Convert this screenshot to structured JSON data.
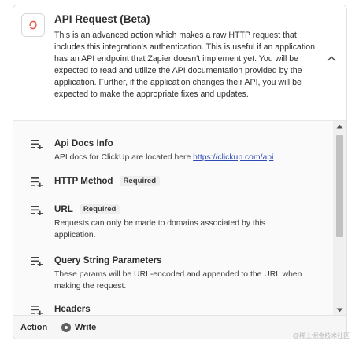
{
  "header": {
    "icon": "api-request-icon",
    "title": "API Request (Beta)",
    "description": "This is an advanced action which makes a raw HTTP request that includes this integration's authentication. This is useful if an application has an API endpoint that Zapier doesn't implement yet. You will be expected to read and utilize the API documentation provided by the application. Further, if the application changes their API, you will be expected to make the appropriate fixes and updates.",
    "collapse_icon": "chevron-up-icon"
  },
  "fields": [
    {
      "label": "Api Docs Info",
      "required": "",
      "description": "API docs for ClickUp are located here ",
      "link": "https://clickup.com/api"
    },
    {
      "label": "HTTP Method",
      "required": "Required",
      "description": ""
    },
    {
      "label": "URL",
      "required": "Required",
      "description": "Requests can only be made to domains associated by this application."
    },
    {
      "label": "Query String Parameters",
      "required": "",
      "description": "These params will be URL-encoded and appended to the URL when making the request."
    },
    {
      "label": "Headers",
      "required": "",
      "description": ""
    }
  ],
  "footer": {
    "label": "Action",
    "step": "Write"
  },
  "watermark": "@稀土掘金技术社区",
  "colors": {
    "link": "#2d4bb7",
    "badge_bg": "#eeeeee",
    "fields_bg": "#fafafa"
  }
}
